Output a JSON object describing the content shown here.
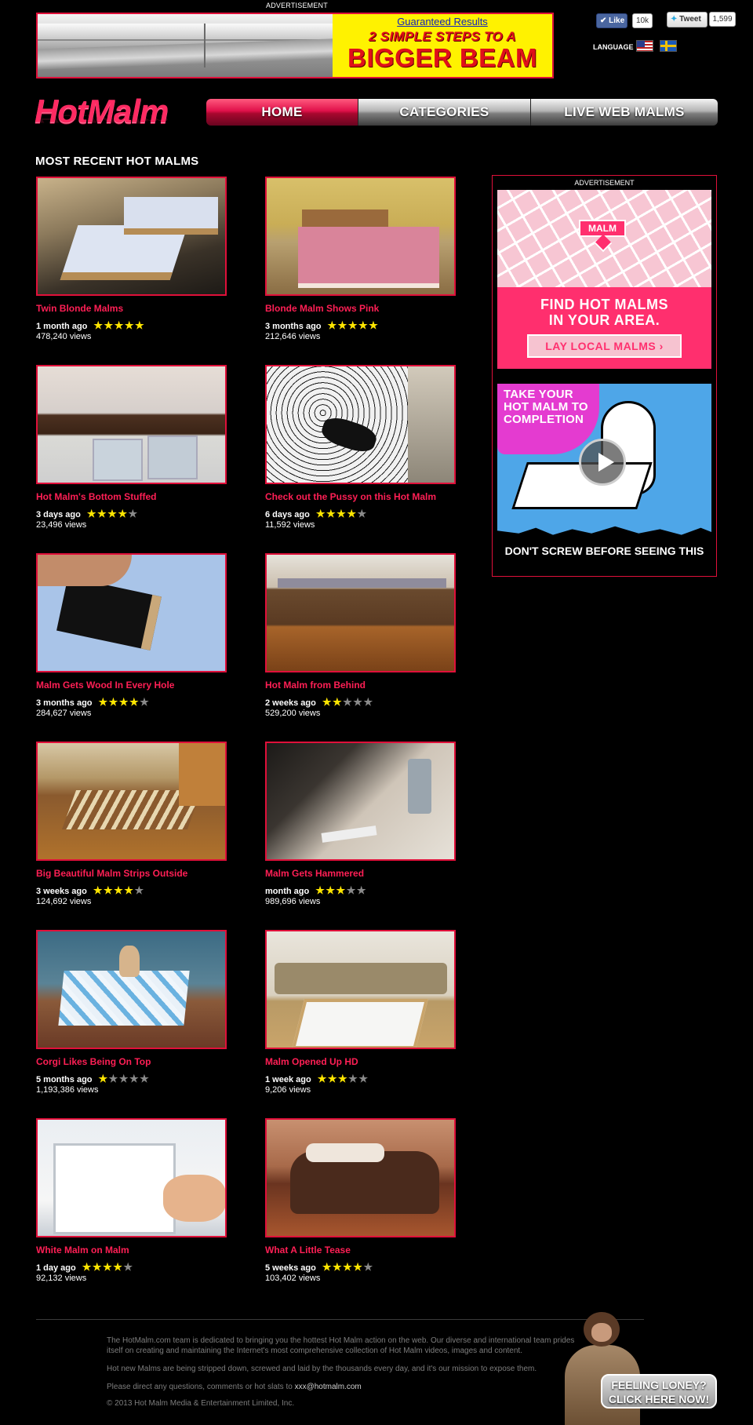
{
  "top_ad": {
    "label": "ADVERTISEMENT",
    "link_text": "Guaranteed Results",
    "headline_small": "2 SIMPLE STEPS TO A",
    "headline_big": "BIGGER BEAM"
  },
  "social": {
    "like_label": "Like",
    "like_count": "10k",
    "tweet_label": "Tweet",
    "tweet_count": "1,599",
    "language_label": "LANGUAGE",
    "flags": [
      "us-flag",
      "sweden-flag"
    ]
  },
  "header": {
    "logo": "HotMalm",
    "nav": [
      {
        "label": "HOME",
        "active": true
      },
      {
        "label": "CATEGORIES",
        "active": false
      },
      {
        "label": "LIVE WEB MALMS",
        "active": false
      }
    ]
  },
  "section_title": "MOST RECENT HOT MALMS",
  "videos": [
    {
      "title": "Twin Blonde Malms",
      "age": "1 month ago",
      "rating": 5,
      "views": "478,240 views"
    },
    {
      "title": "Blonde Malm Shows Pink",
      "age": "3 months ago",
      "rating": 5,
      "views": "212,646 views"
    },
    {
      "title": "Hot Malm's Bottom Stuffed",
      "age": "3 days ago",
      "rating": 4,
      "views": "23,496 views"
    },
    {
      "title": "Check out the Pussy on this Hot Malm",
      "age": "6 days ago",
      "rating": 4,
      "views": "11,592 views"
    },
    {
      "title": "Malm Gets Wood In Every Hole",
      "age": "3 months ago",
      "rating": 4,
      "views": "284,627 views"
    },
    {
      "title": "Hot Malm from Behind",
      "age": "2 weeks ago",
      "rating": 2,
      "views": "529,200 views"
    },
    {
      "title": "Big Beautiful Malm Strips Outside",
      "age": "3 weeks ago",
      "rating": 4,
      "views": "124,692 views"
    },
    {
      "title": "Malm Gets Hammered",
      "age": "month ago",
      "rating": 3,
      "views": "989,696 views"
    },
    {
      "title": "Corgi Likes Being On Top",
      "age": "5 months ago",
      "rating": 1,
      "views": "1,193,386 views"
    },
    {
      "title": "Malm Opened Up HD",
      "age": "1 week ago",
      "rating": 3,
      "views": "9,206 views"
    },
    {
      "title": "White Malm on Malm",
      "age": "1 day ago",
      "rating": 4,
      "views": "92,132 views"
    },
    {
      "title": "What A Little Tease",
      "age": "5 weeks ago",
      "rating": 4,
      "views": "103,402 views"
    }
  ],
  "side_ad": {
    "label": "ADVERTISEMENT",
    "pin_text": "MALM",
    "headline_line1": "FIND HOT MALMS",
    "headline_line2": "IN YOUR AREA.",
    "button_label": "LAY LOCAL MALMS ›",
    "video_title_line1": "TAKE YOUR",
    "video_title_line2": "HOT MALM TO",
    "video_title_line3": "COMPLETION",
    "video_caption": "DON'T SCREW BEFORE SEEING THIS"
  },
  "footer": {
    "para1": "The HotMalm.com team is dedicated to bringing you the hottest Hot Malm action on the web. Our diverse and international team prides itself on creating and maintaining the Internet's most comprehensive collection of Hot Malm videos, images and content.",
    "para2": "Hot new Malms are being stripped down, screwed and laid by the thousands every day, and it's our mission to expose them.",
    "para3_prefix": "Please direct any questions, comments or hot slats to ",
    "para3_email": "xxx@hotmalm.com",
    "copyright": "© 2013 Hot Malm Media & Entertainment Limited, Inc.",
    "cta_line1": "FEELING LONEY?",
    "cta_line2": "CLICK HERE NOW!"
  },
  "colors": {
    "accent": "#e0103a",
    "title_pink": "#ff1f55",
    "star_on": "#ffe600",
    "star_off": "#8a8a8a",
    "background": "#000000"
  }
}
